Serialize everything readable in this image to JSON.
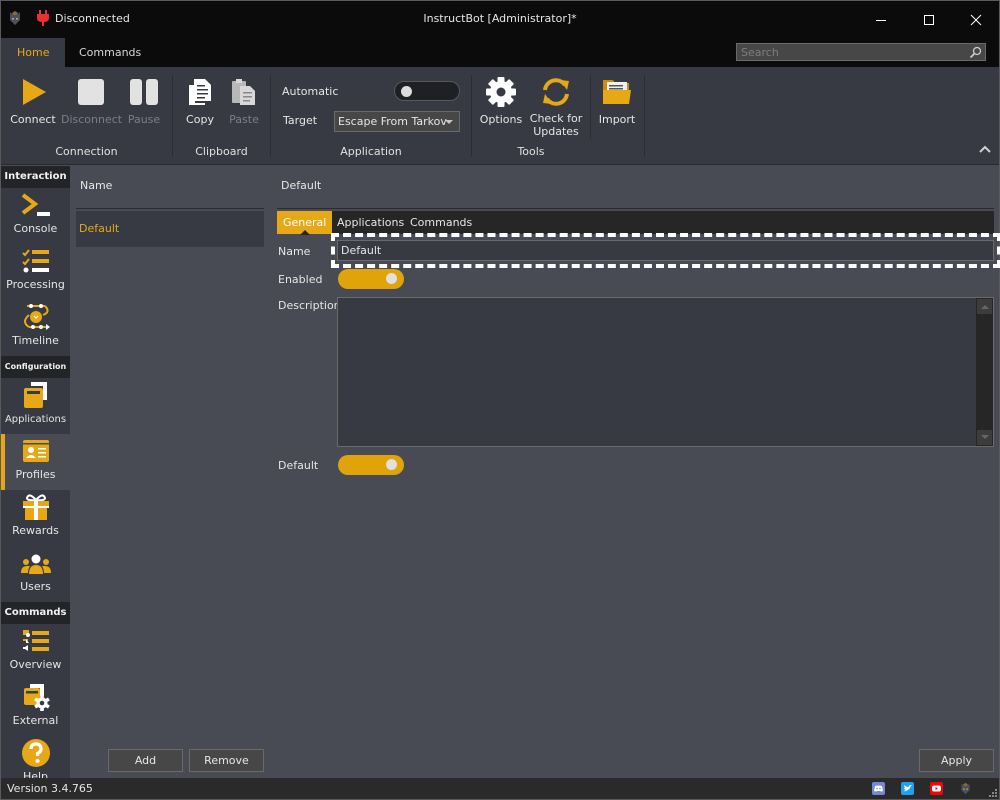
{
  "window": {
    "title": "InstructBot [Administrator]*",
    "connection_status": "Disconnected"
  },
  "ribbon_tabs": [
    {
      "label": "Home",
      "active": true
    },
    {
      "label": "Commands",
      "active": false
    }
  ],
  "search": {
    "placeholder": "Search",
    "value": ""
  },
  "ribbon": {
    "connection": {
      "label": "Connection",
      "buttons": [
        {
          "label": "Connect",
          "icon": "play-icon",
          "enabled": true
        },
        {
          "label": "Disconnect",
          "icon": "stop-icon",
          "enabled": false
        },
        {
          "label": "Pause",
          "icon": "pause-icon",
          "enabled": false
        }
      ]
    },
    "clipboard": {
      "label": "Clipboard",
      "buttons": [
        {
          "label": "Copy",
          "icon": "copy-icon",
          "enabled": true
        },
        {
          "label": "Paste",
          "icon": "paste-icon",
          "enabled": false
        }
      ]
    },
    "application": {
      "label": "Application",
      "automatic_label": "Automatic",
      "automatic_on": false,
      "target_label": "Target",
      "target_value": "Escape From Tarkov"
    },
    "tools": {
      "label": "Tools",
      "buttons": [
        {
          "label": "Options",
          "icon": "gear-icon"
        },
        {
          "label": "Check for Updates",
          "line1": "Check for",
          "line2": "Updates",
          "icon": "refresh-icon"
        }
      ]
    },
    "import": {
      "label": "Import",
      "icon": "folder-icon"
    }
  },
  "sidebar": {
    "sections": [
      {
        "header": "Interaction",
        "items": [
          {
            "label": "Console",
            "icon": "console-icon"
          },
          {
            "label": "Processing",
            "icon": "checklist-icon"
          },
          {
            "label": "Timeline",
            "icon": "timeline-icon"
          }
        ]
      },
      {
        "header": "Configuration",
        "items": [
          {
            "label": "Applications",
            "icon": "applications-icon"
          },
          {
            "label": "Profiles",
            "icon": "profile-card-icon",
            "active": true
          },
          {
            "label": "Rewards",
            "icon": "gift-icon"
          },
          {
            "label": "Users",
            "icon": "users-icon"
          }
        ]
      },
      {
        "header": "Commands",
        "items": [
          {
            "label": "Overview",
            "icon": "overview-icon"
          },
          {
            "label": "External",
            "icon": "external-icon"
          },
          {
            "label": "Help",
            "icon": "help-icon"
          }
        ]
      }
    ]
  },
  "profiles_list": {
    "header": "Name",
    "items": [
      {
        "name": "Default",
        "selected": true
      }
    ],
    "add_label": "Add",
    "remove_label": "Remove"
  },
  "detail": {
    "title": "Default",
    "tabs": [
      {
        "label": "General",
        "active": true
      },
      {
        "label": "Applications",
        "active": false
      },
      {
        "label": "Commands",
        "active": false
      }
    ],
    "fields": {
      "name_label": "Name",
      "name_value": "Default",
      "enabled_label": "Enabled",
      "enabled_on": true,
      "description_label": "Description",
      "description_value": "",
      "default_label": "Default",
      "default_on": true
    },
    "apply_label": "Apply"
  },
  "status": {
    "version": "Version 3.4.765"
  },
  "colors": {
    "accent": "#e6a817",
    "titlebar": "#0b0b0b",
    "ribbon": "#373a42",
    "panel": "#484b53",
    "discord": "#7289da",
    "twitter": "#1da1f2",
    "youtube": "#ff0000"
  }
}
